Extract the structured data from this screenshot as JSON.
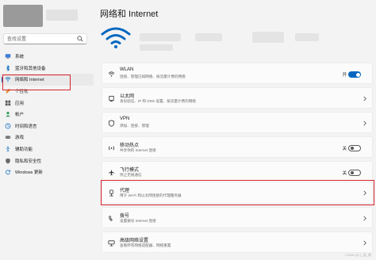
{
  "window": {
    "title": "网络和 Internet"
  },
  "search": {
    "placeholder": "查找设置"
  },
  "sidebar": {
    "items": [
      {
        "label": "系统",
        "icon": "monitor-icon"
      },
      {
        "label": "蓝牙和其他设备",
        "icon": "bluetooth-icon"
      },
      {
        "label": "网络和 Internet",
        "icon": "wifi-icon",
        "active": true
      },
      {
        "label": "个性化",
        "icon": "brush-icon"
      },
      {
        "label": "应用",
        "icon": "apps-icon"
      },
      {
        "label": "帐户",
        "icon": "person-icon"
      },
      {
        "label": "时间和语言",
        "icon": "globe-clock-icon"
      },
      {
        "label": "游戏",
        "icon": "gamepad-icon"
      },
      {
        "label": "辅助功能",
        "icon": "accessibility-icon"
      },
      {
        "label": "隐私和安全性",
        "icon": "shield-icon"
      },
      {
        "label": "Windows 更新",
        "icon": "update-icon"
      }
    ]
  },
  "cards": [
    {
      "title": "WLAN",
      "subtitle": "连接、管理已知网络、按流量计费的网络",
      "icon": "wifi-icon",
      "toggle": "开",
      "toggle_on": true
    },
    {
      "title": "以太网",
      "subtitle": "身份验证、IP 和 DNS 设置、按流量计费的网络",
      "icon": "ethernet-icon"
    },
    {
      "title": "VPN",
      "subtitle": "添加、连接、管理",
      "icon": "vpn-shield-icon"
    },
    {
      "title": "移动热点",
      "subtitle": "共享你的 Internet 连接",
      "icon": "hotspot-icon",
      "toggle": "关",
      "toggle_on": false
    },
    {
      "title": "飞行模式",
      "subtitle": "停止无线通信",
      "icon": "airplane-icon",
      "toggle": "关",
      "toggle_on": false
    },
    {
      "title": "代理",
      "subtitle": "用于 Wi-Fi 和以太网连接的代理服务器",
      "icon": "proxy-icon"
    },
    {
      "title": "拨号",
      "subtitle": "设置拨号 Internet 连接",
      "icon": "dialup-icon"
    },
    {
      "title": "高级网络设置",
      "subtitle": "查看所有网络适配器、网络重置",
      "icon": "network-adapter-icon"
    }
  ],
  "colors": {
    "accent": "#0067c0",
    "highlight": "#d9232d"
  },
  "watermark": "CSDN @儿_凯_南"
}
